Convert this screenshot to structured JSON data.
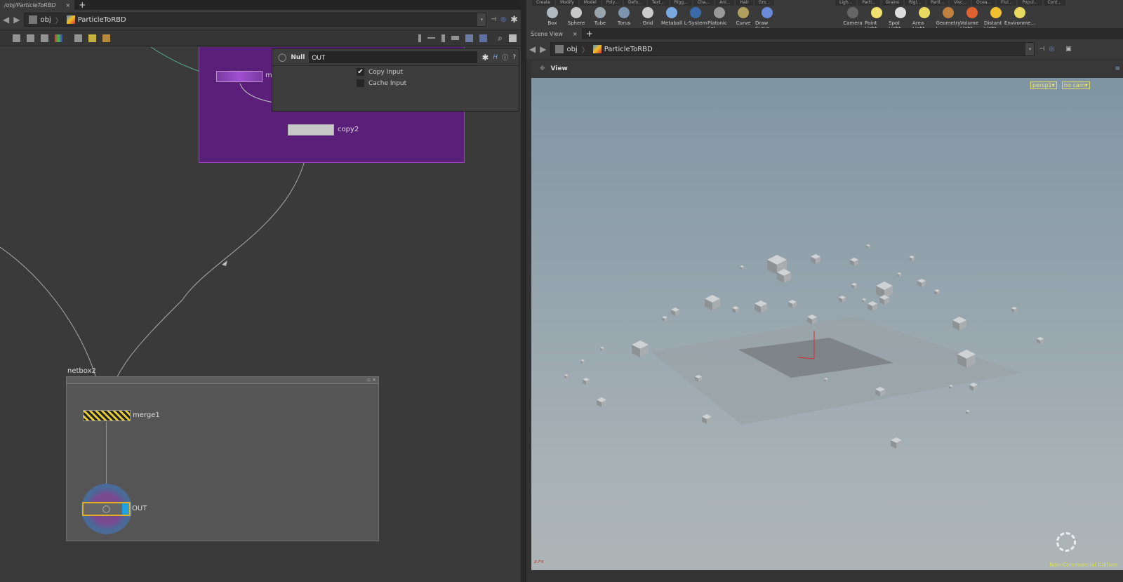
{
  "left_pane": {
    "tab_label": "/obj/ParticleToRBD",
    "path": {
      "root": "obj",
      "current": "ParticleToRBD"
    },
    "params": {
      "node_type": "Null",
      "node_name": "OUT",
      "checkboxes": [
        {
          "label": "Copy Input",
          "checked": true
        },
        {
          "label": "Cache Input",
          "checked": false
        }
      ]
    },
    "network": {
      "netbox_label": "netbox2",
      "nodes": {
        "partial_node_label": "m",
        "copy": "copy2",
        "merge": "merge1",
        "out": "OUT"
      }
    }
  },
  "shelf": {
    "left_tabs": [
      "Create",
      "Modify",
      "Model",
      "Poly...",
      "Defo...",
      "Text...",
      "Rigg...",
      "Cha...",
      "Ani...",
      "Hair",
      "Gro..."
    ],
    "left_tools": [
      {
        "label": "Box",
        "color": "#b0b8c0"
      },
      {
        "label": "Sphere",
        "color": "#c8c8c8"
      },
      {
        "label": "Tube",
        "color": "#9aa4ac"
      },
      {
        "label": "Torus",
        "color": "#7d93b0"
      },
      {
        "label": "Grid",
        "color": "#ccc"
      },
      {
        "label": "Metaball",
        "color": "#7aa8e0"
      },
      {
        "label": "L-System",
        "color": "#3a6aa8"
      },
      {
        "label": "Platonic Sol...",
        "color": "#999"
      },
      {
        "label": "Curve",
        "color": "#b0a060"
      },
      {
        "label": "Draw Curve",
        "color": "#6a8ad8"
      }
    ],
    "right_tabs": [
      "Ligh...",
      "Parti...",
      "Grains",
      "Rigi...",
      "Partl...",
      "Visc...",
      "Ocea...",
      "Flui...",
      "Popul...",
      "Cont..."
    ],
    "right_tools": [
      {
        "label": "Camera",
        "color": "#666"
      },
      {
        "label": "Point Light",
        "color": "#f0e070"
      },
      {
        "label": "Spot Light",
        "color": "#ddd"
      },
      {
        "label": "Area Light",
        "color": "#e8d860"
      },
      {
        "label": "Geometry L...",
        "color": "#c08040"
      },
      {
        "label": "Volume Light",
        "color": "#e06030"
      },
      {
        "label": "Distant Light",
        "color": "#f0c030"
      },
      {
        "label": "Environme...",
        "color": "#e8d860"
      }
    ]
  },
  "scene_view": {
    "tab_label": "Scene View",
    "path": {
      "root": "obj",
      "current": "ParticleToRBD"
    },
    "view_label": "View",
    "camera_menu": "persp1",
    "cam_menu": "no cam",
    "watermark": "Non-Commercial Edition"
  }
}
